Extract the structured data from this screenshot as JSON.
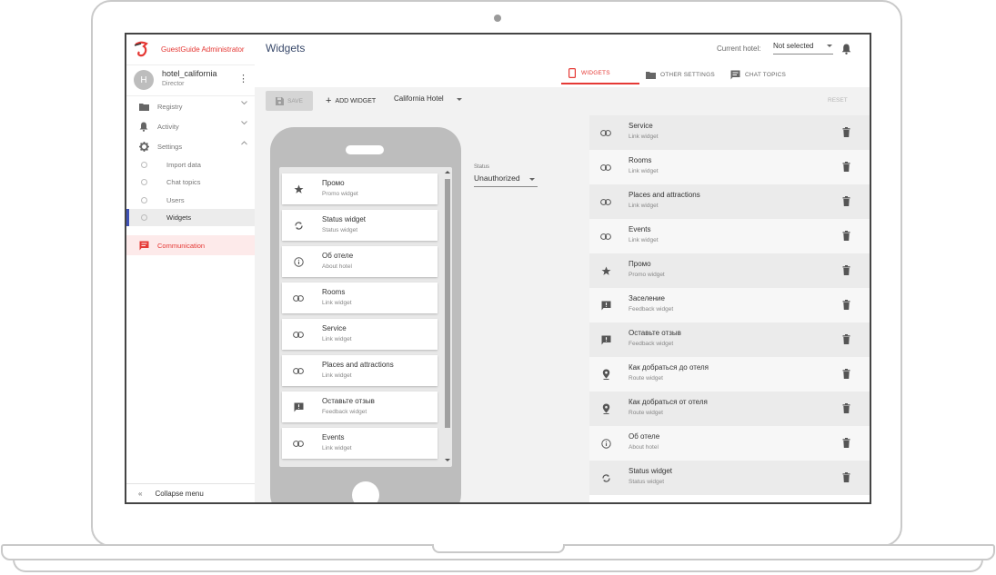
{
  "app": {
    "title": "GuestGuide Administrator"
  },
  "user": {
    "initial": "H",
    "name": "hotel_california",
    "role": "Director"
  },
  "nav": {
    "registry": "Registry",
    "activity": "Activity",
    "settings": "Settings",
    "sub": [
      "Import data",
      "Chat topics",
      "Users",
      "Widgets"
    ],
    "communication": "Communication",
    "collapse": "Collapse menu"
  },
  "header": {
    "title": "Widgets",
    "hotel_label": "Current hotel:",
    "hotel_value": "Not selected"
  },
  "tabs": [
    "WIDGETS",
    "OTHER SETTINGS",
    "CHAT TOPICS"
  ],
  "toolbar": {
    "save": "SAVE",
    "add": "ADD WIDGET",
    "hotel": "California Hotel",
    "reset": "RESET"
  },
  "status": {
    "label": "Status",
    "value": "Unauthorized"
  },
  "phone_cards": [
    {
      "title": "Промо",
      "sub": "Promo widget",
      "icon": "star-icon"
    },
    {
      "title": "Status widget",
      "sub": "Status widget",
      "icon": "sync-icon"
    },
    {
      "title": "Об отеле",
      "sub": "About hotel",
      "icon": "info-icon"
    },
    {
      "title": "Rooms",
      "sub": "Link widget",
      "icon": "link-icon"
    },
    {
      "title": "Service",
      "sub": "Link widget",
      "icon": "link-icon"
    },
    {
      "title": "Places and attractions",
      "sub": "Link widget",
      "icon": "link-icon"
    },
    {
      "title": "Оставьте отзыв",
      "sub": "Feedback widget",
      "icon": "feedback-icon"
    },
    {
      "title": "Events",
      "sub": "Link widget",
      "icon": "link-icon"
    }
  ],
  "widgets": [
    {
      "title": "Service",
      "sub": "Link widget",
      "icon": "link-icon"
    },
    {
      "title": "Rooms",
      "sub": "Link widget",
      "icon": "link-icon"
    },
    {
      "title": "Places and attractions",
      "sub": "Link widget",
      "icon": "link-icon"
    },
    {
      "title": "Events",
      "sub": "Link widget",
      "icon": "link-icon"
    },
    {
      "title": "Промо",
      "sub": "Promo widget",
      "icon": "star-icon"
    },
    {
      "title": "Заселение",
      "sub": "Feedback widget",
      "icon": "feedback-icon"
    },
    {
      "title": "Оставьте отзыв",
      "sub": "Feedback widget",
      "icon": "feedback-icon"
    },
    {
      "title": "Как добраться до отеля",
      "sub": "Route widget",
      "icon": "location-icon"
    },
    {
      "title": "Как добраться от отеля",
      "sub": "Route widget",
      "icon": "location-icon"
    },
    {
      "title": "Об отеле",
      "sub": "About hotel",
      "icon": "info-icon"
    },
    {
      "title": "Status widget",
      "sub": "Status widget",
      "icon": "sync-icon"
    }
  ],
  "colors": {
    "accent": "#e53935",
    "nav_active": "#3f51b5"
  }
}
